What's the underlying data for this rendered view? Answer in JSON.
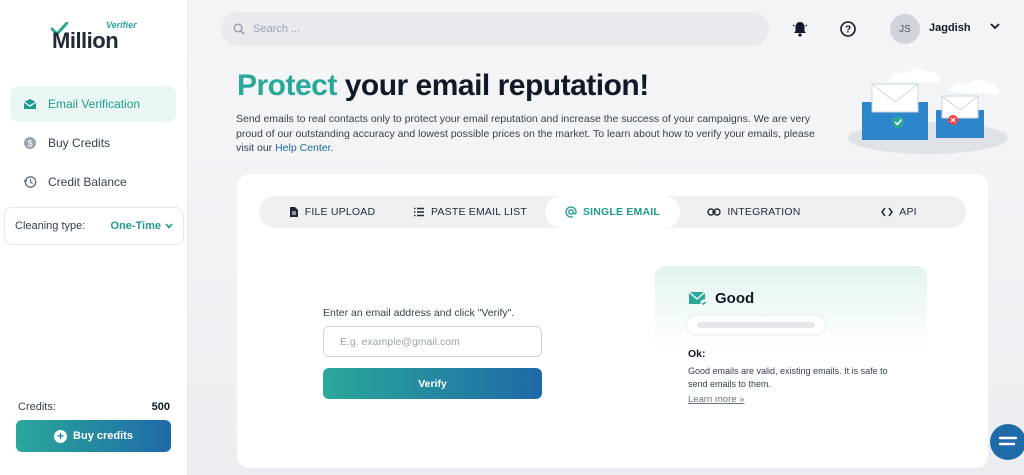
{
  "brand": {
    "small": "Verifier",
    "name": "Million"
  },
  "sidebar": {
    "items": [
      {
        "label": "Email Verification",
        "icon": "envelope-icon",
        "active": true
      },
      {
        "label": "Buy Credits",
        "icon": "dollar-coin-icon"
      },
      {
        "label": "Credit Balance",
        "icon": "history-icon"
      }
    ],
    "cleaning_label": "Cleaning type:",
    "cleaning_value": "One-Time",
    "credits_label": "Credits:",
    "credits_amount": "500",
    "buy_button": "Buy credits"
  },
  "header": {
    "search_placeholder": "Search ...",
    "avatar_initials": "JS",
    "user_name": "Jagdish"
  },
  "main": {
    "headline_accent": "Protect",
    "headline_rest": " your email reputation!",
    "lead": "Send emails to real contacts only to protect your email reputation and increase the success of your campaigns. We are very proud of our outstanding accuracy and lowest possible prices on the market. To learn about how to verify your emails, please visit our ",
    "lead_link": "Help Center",
    "lead_end": ".",
    "tabs": [
      {
        "label": "FILE UPLOAD",
        "icon": "file-icon"
      },
      {
        "label": "PASTE EMAIL LIST",
        "icon": "list-icon"
      },
      {
        "label": "SINGLE EMAIL",
        "icon": "at-icon",
        "active": true
      },
      {
        "label": "INTEGRATION",
        "icon": "link-icon"
      },
      {
        "label": "API",
        "icon": "code-icon"
      }
    ],
    "prompt": "Enter an email address and click \"Verify\".",
    "input_placeholder": "E.g. example@gmail.com",
    "verify_button": "Verify",
    "result": {
      "title": "Good",
      "status": "Ok:",
      "description": "Good emails are valid, existing emails. It is safe to send emails to them.",
      "learn_more": "Learn more »"
    }
  },
  "colors": {
    "accent": "#2aa89a",
    "accent_dark": "#1f6aa8"
  }
}
